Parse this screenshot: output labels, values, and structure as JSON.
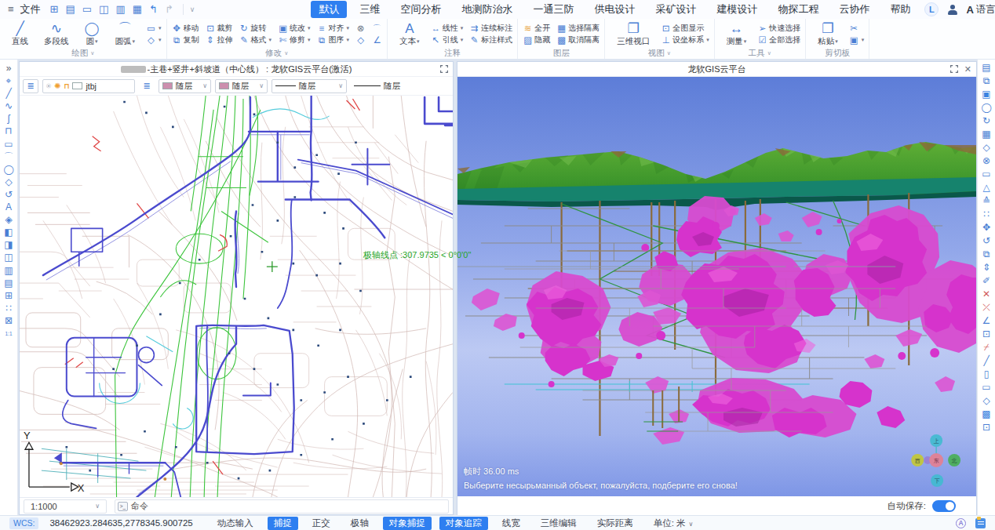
{
  "colors": {
    "accent": "#2e7ff0",
    "icon_blue": "#4a7fd4",
    "swatch_pink": "#cc8fae",
    "ore_magenta": "#d836ce"
  },
  "menubar": {
    "hamburger": "hamburger",
    "file_label": "文件",
    "quick": [
      "new",
      "doc",
      "folder-open",
      "save",
      "export",
      "print",
      "undo",
      "redo"
    ],
    "tabs": [
      {
        "label": "默认",
        "active": true
      },
      {
        "label": "三维"
      },
      {
        "label": "空间分析"
      },
      {
        "label": "地测防治水"
      },
      {
        "label": "一通三防"
      },
      {
        "label": "供电设计"
      },
      {
        "label": "采矿设计"
      },
      {
        "label": "建模设计"
      },
      {
        "label": "物探工程"
      },
      {
        "label": "云协作"
      },
      {
        "label": "帮助"
      }
    ],
    "user_initial": "L",
    "language_label": "语言"
  },
  "ribbon": {
    "groups": [
      {
        "label": "绘图",
        "arrow": true,
        "big": [
          {
            "icon": "line",
            "label": "直线"
          },
          {
            "icon": "polyline",
            "label": "多段线"
          },
          {
            "icon": "circle",
            "label": "圆",
            "dd": true
          },
          {
            "icon": "arc",
            "label": "圆弧",
            "dd": true
          }
        ],
        "small": [
          {
            "icon": "rect",
            "label": "",
            "dd": true
          },
          {
            "icon": "polygon",
            "label": "",
            "dd": true
          }
        ]
      },
      {
        "label": "修改",
        "arrow": true,
        "big": [],
        "small": [
          {
            "icon": "move",
            "label": "移动"
          },
          {
            "icon": "copy",
            "label": "复制"
          },
          {
            "icon": "clip",
            "label": "裁剪"
          },
          {
            "icon": "stretch",
            "label": "拉伸"
          },
          {
            "icon": "rotate",
            "label": "旋转"
          },
          {
            "icon": "format",
            "label": "格式",
            "dd": true
          },
          {
            "icon": "unify",
            "label": "统改",
            "dd": true
          },
          {
            "icon": "trim",
            "label": "修剪",
            "dd": true
          },
          {
            "icon": "align",
            "label": "对齐",
            "dd": true
          },
          {
            "icon": "order",
            "label": "图序",
            "dd": true
          },
          {
            "icon": "trash",
            "label": ""
          },
          {
            "icon": "box3d",
            "label": ""
          },
          {
            "icon": "fillet",
            "label": ""
          },
          {
            "icon": "chamfer",
            "label": ""
          }
        ]
      },
      {
        "label": "注释",
        "arrow": false,
        "big": [
          {
            "icon": "text",
            "label": "文本",
            "dd": true
          }
        ],
        "small": [
          {
            "icon": "linear",
            "label": "线性",
            "dd": true
          },
          {
            "icon": "leader",
            "label": "引线",
            "dd": true
          },
          {
            "icon": "cont-dim",
            "label": "连续标注"
          },
          {
            "icon": "dim-style",
            "label": "标注样式"
          }
        ]
      },
      {
        "label": "图层",
        "arrow": false,
        "big": [],
        "small": [
          {
            "icon": "layers-on",
            "label": "全开"
          },
          {
            "icon": "layers-hide",
            "label": "隐藏"
          },
          {
            "icon": "iso-select",
            "label": "选择隔离"
          },
          {
            "icon": "iso-cancel",
            "label": "取消隔离"
          }
        ]
      },
      {
        "label": "视图",
        "arrow": true,
        "big": [
          {
            "icon": "viewport",
            "label": "三维视口"
          }
        ],
        "small": [
          {
            "icon": "fit-view",
            "label": "全图显示"
          },
          {
            "icon": "coord-sys",
            "label": "设坐标系",
            "dd": true
          }
        ]
      },
      {
        "label": "工具",
        "arrow": true,
        "big": [
          {
            "icon": "measure",
            "label": "测量",
            "dd": true
          }
        ],
        "small": [
          {
            "icon": "quick-select",
            "label": "快速选择"
          },
          {
            "icon": "select-all",
            "label": "全部选择"
          }
        ]
      },
      {
        "label": "剪切板",
        "arrow": false,
        "big": [
          {
            "icon": "paste",
            "label": "粘贴",
            "dd": true
          }
        ],
        "small": [
          {
            "icon": "cut",
            "label": ""
          },
          {
            "icon": "extra",
            "label": "",
            "dd": true
          }
        ]
      }
    ]
  },
  "leftbar": {
    "icons": [
      "collapse",
      "fit",
      "line",
      "polyline",
      "spline",
      "region",
      "rect",
      "arc",
      "circle",
      "polygon",
      "arc2",
      "text",
      "block",
      "align-left",
      "align-right",
      "align-center",
      "distribute-h",
      "distribute-v",
      "equal-space",
      "match",
      "zoom-extents",
      "scale-1-1"
    ]
  },
  "rightbar": {
    "icons": [
      "props",
      "paste2",
      "select-box",
      "lasso",
      "refresh",
      "map",
      "box",
      "trash2",
      "frame",
      "mirror",
      "stamp",
      "tiles",
      "move2",
      "rotate2",
      "dup",
      "stretch2",
      "screw",
      "break",
      "delete-x",
      "angle",
      "crop2",
      "cutline",
      "slope",
      "clip1",
      "clip2",
      "cube",
      "hatch",
      "edit-attr"
    ]
  },
  "panel2d": {
    "title": "-主巷+竖井+斜坡道（中心线） : 龙软GIS云平台(激活)",
    "layerbar": {
      "name_value": "jtbj",
      "combos": [
        {
          "label": "随层"
        },
        {
          "label": "随层"
        },
        {
          "label": "随层"
        },
        {
          "label": "随层"
        }
      ]
    },
    "axis_x": "X",
    "axis_y": "Y",
    "footer": {
      "scale": "1:1000",
      "command_label": "命令",
      "prompt_icon": ">_"
    }
  },
  "panel3d": {
    "title": "龙软GIS云平台",
    "frame_time": "帧时  36.00 ms",
    "message": "Выберите несырьманный объект, пожалуйста, подберите его снова!",
    "autosave_label": "自动保存:",
    "gizmo": {
      "up": "上",
      "down": "下",
      "west": "西",
      "east": "东",
      "north": "北"
    }
  },
  "tooltip": {
    "text": "极轴线点 :307.9735 < 0°0'0\""
  },
  "statusbar": {
    "wcs_label": "WCS:",
    "coords": "38462923.284635,2778345.900725",
    "items": [
      {
        "label": "动态输入"
      },
      {
        "label": "捕捉",
        "active": true
      },
      {
        "label": "正交"
      },
      {
        "label": "极轴"
      },
      {
        "label": "对象捕捉",
        "active": true
      },
      {
        "label": "对象追踪",
        "active": true
      },
      {
        "label": "线宽"
      },
      {
        "label": "三维编辑"
      },
      {
        "label": "实际距离"
      },
      {
        "label": "单位: 米",
        "dd": true
      }
    ]
  }
}
